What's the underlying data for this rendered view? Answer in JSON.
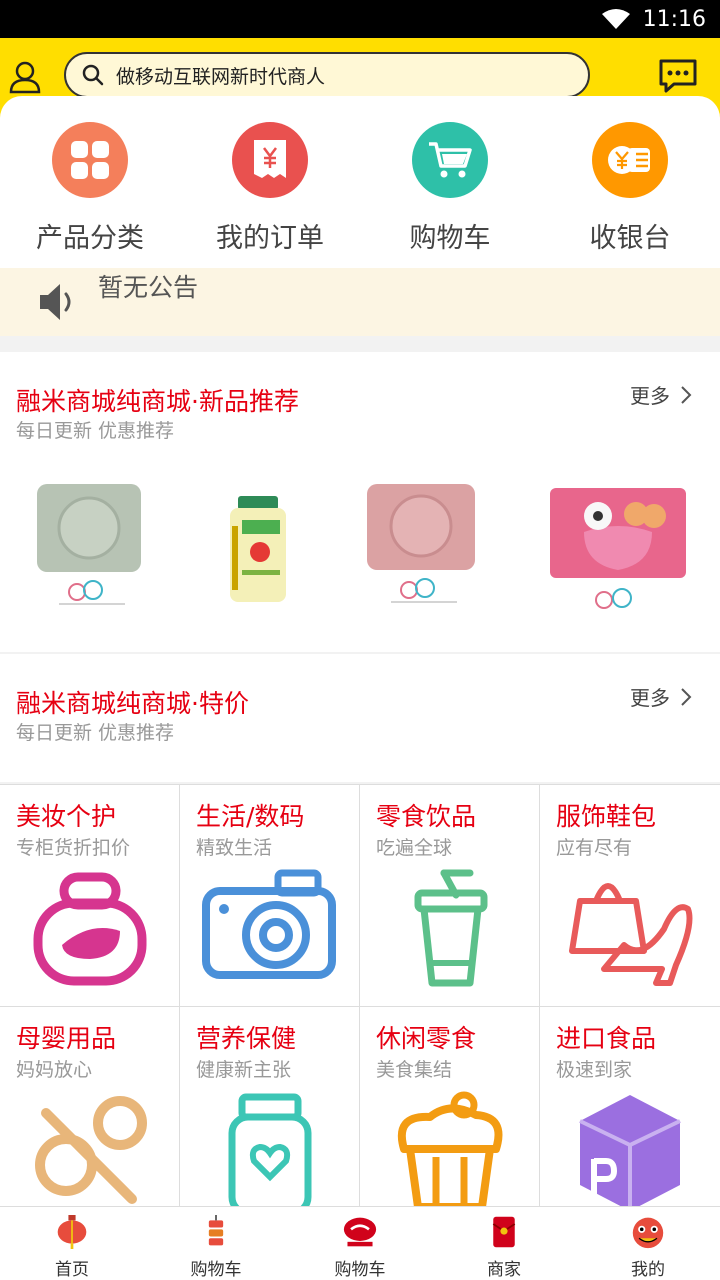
{
  "status_bar": {
    "time": "11:16"
  },
  "search": {
    "placeholder": "做移动互联网新时代商人"
  },
  "quick_actions": [
    {
      "label": "产品分类",
      "icon": "grid-icon",
      "color": "#f47f5b"
    },
    {
      "label": "我的订单",
      "icon": "receipt-icon",
      "color": "#e9514f"
    },
    {
      "label": "购物车",
      "icon": "cart-icon",
      "color": "#2ec0a8"
    },
    {
      "label": "收银台",
      "icon": "wallet-icon",
      "color": "#ff9800"
    }
  ],
  "notice": {
    "text": "暂无公告"
  },
  "sections": [
    {
      "title": "融米商城纯商城·新品推荐",
      "subtitle": "每日更新 优惠推荐",
      "more": "更多"
    },
    {
      "title": "融米商城纯商城·特价",
      "subtitle": "每日更新 优惠推荐",
      "more": "更多"
    }
  ],
  "categories": [
    {
      "title": "美妆个护",
      "subtitle": "专柜货折扣价",
      "icon": "perfume-icon",
      "color": "#d6358f"
    },
    {
      "title": "生活/数码",
      "subtitle": "精致生活",
      "icon": "camera-icon",
      "color": "#4a90d9"
    },
    {
      "title": "零食饮品",
      "subtitle": "吃遍全球",
      "icon": "drink-cup-icon",
      "color": "#5cc08a"
    },
    {
      "title": "服饰鞋包",
      "subtitle": "应有尽有",
      "icon": "bag-shoe-icon",
      "color": "#e85a5a"
    },
    {
      "title": "母婴用品",
      "subtitle": "妈妈放心",
      "icon": "pacifier-icon",
      "color": "#e8b67a"
    },
    {
      "title": "营养保健",
      "subtitle": "健康新主张",
      "icon": "supplement-jar-icon",
      "color": "#3cc6b5"
    },
    {
      "title": "休闲零食",
      "subtitle": "美食集结",
      "icon": "cupcake-icon",
      "color": "#f39c12"
    },
    {
      "title": "进口食品",
      "subtitle": "极速到家",
      "icon": "import-box-icon",
      "color": "#9b6fe0"
    }
  ],
  "tabs": [
    {
      "label": "首页",
      "icon": "lantern-icon"
    },
    {
      "label": "购物车",
      "icon": "firecracker-icon"
    },
    {
      "label": "购物车",
      "icon": "brand-logo-icon"
    },
    {
      "label": "商家",
      "icon": "red-envelope-icon"
    },
    {
      "label": "我的",
      "icon": "lion-head-icon"
    }
  ]
}
